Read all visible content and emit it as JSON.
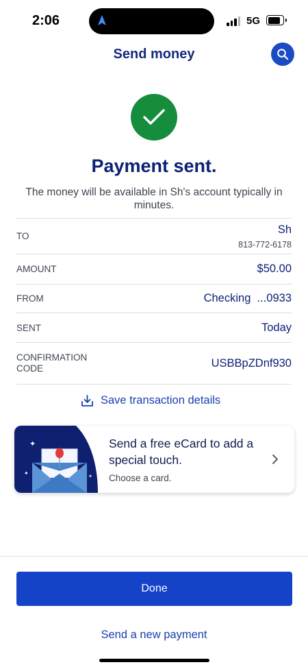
{
  "status_bar": {
    "time": "2:06",
    "network": "5G"
  },
  "header": {
    "title": "Send money",
    "search_icon": "search-icon"
  },
  "confirmation": {
    "headline": "Payment sent.",
    "message": "The money will be available in Sh's account typically in minutes."
  },
  "details": {
    "to": {
      "label": "TO",
      "name": "Sh",
      "phone": "813-772-6178"
    },
    "amount": {
      "label": "AMOUNT",
      "value": "$50.00"
    },
    "from": {
      "label": "FROM",
      "value": "Checking  ...0933"
    },
    "sent": {
      "label": "SENT",
      "value": "Today"
    },
    "confirmation_code": {
      "label": "CONFIRMATION CODE",
      "value": "USBBpZDnf930"
    }
  },
  "save_link": {
    "label": "Save transaction details",
    "icon": "download-icon"
  },
  "ecard": {
    "title": "Send a free eCard to add a special touch.",
    "subtitle": "Choose a card."
  },
  "actions": {
    "done": "Done",
    "new_payment": "Send a new payment"
  },
  "colors": {
    "primary_blue": "#1443c8",
    "navy_text": "#0c2074",
    "success_green": "#168c3d",
    "ecard_art_navy": "#0f2071"
  }
}
